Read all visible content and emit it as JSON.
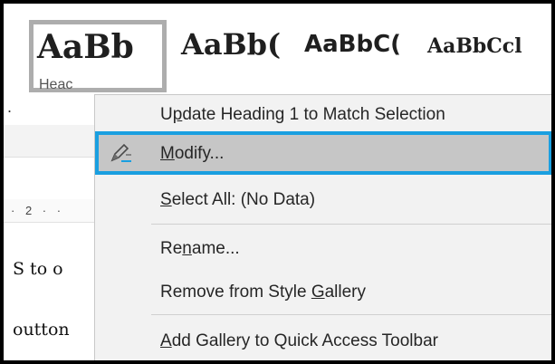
{
  "gallery": {
    "styles": [
      {
        "preview": "AaBb",
        "caption": "Heac"
      },
      {
        "preview": "AaBb("
      },
      {
        "preview": "AaBbC("
      },
      {
        "preview": "AaBbCcl"
      }
    ]
  },
  "ruler": {
    "text": "· 2 · ·"
  },
  "document": {
    "line1": "S to o",
    "line2": "outton"
  },
  "context_menu": {
    "items": [
      {
        "id": "update",
        "label_pre": "U",
        "label_ul": "p",
        "label_post": "date Heading 1 to Match Selection"
      },
      {
        "id": "modify",
        "label_pre": "",
        "label_ul": "M",
        "label_post": "odify...",
        "icon": "pencil-style-icon",
        "highlighted": true
      },
      {
        "id": "select-all",
        "label_pre": "",
        "label_ul": "S",
        "label_post": "elect All: (No Data)"
      },
      {
        "id": "rename",
        "label_pre": "Re",
        "label_ul": "n",
        "label_post": "ame..."
      },
      {
        "id": "remove",
        "label_pre": "Remove from Style ",
        "label_ul": "G",
        "label_post": "allery"
      },
      {
        "id": "add-qat",
        "label_pre": "",
        "label_ul": "A",
        "label_post": "dd Gallery to Quick Access Toolbar"
      }
    ]
  },
  "colors": {
    "highlight_border": "#1a9fe0",
    "highlight_fill": "#c6c6c6",
    "menu_bg": "#f2f2f2",
    "selected_tile_border": "#adadad"
  }
}
